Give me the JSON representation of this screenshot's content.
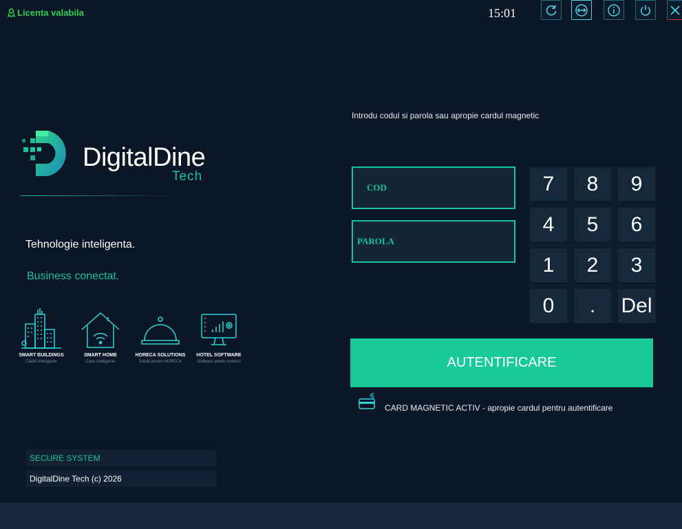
{
  "topbar": {
    "license": "Licenta valabila",
    "clock": "15:01",
    "icons": [
      "refresh-icon",
      "resize-icon",
      "info-icon",
      "power-icon",
      "close-icon"
    ]
  },
  "brand": {
    "name": "DigitalDine",
    "sub": "Tech",
    "tagline1": "Tehnologie inteligenta.",
    "tagline2": "Business conectat."
  },
  "features": [
    {
      "title": "SMART BUILDINGS",
      "sub": "Clădiri inteligente",
      "icon": "buildings-icon"
    },
    {
      "title": "SMART HOME",
      "sub": "Case inteligente",
      "icon": "smart-home-icon"
    },
    {
      "title": "HORECA SOLUTIONS",
      "sub": "Soluții pentru HORECA",
      "icon": "cloche-icon"
    },
    {
      "title": "HOTEL SOFTWARE",
      "sub": "Software pentru hoteluri",
      "icon": "monitor-chart-icon"
    }
  ],
  "footer": {
    "secure": "SECURE SYSTEM",
    "copyright": "DigitalDine Tech (c) 2026"
  },
  "login": {
    "instruction": "Introdu codul si parola sau apropie cardul magnetic",
    "code_label": "COD",
    "password_label": "PAROLA",
    "keys": [
      "7",
      "8",
      "9",
      "4",
      "5",
      "6",
      "1",
      "2",
      "3",
      "0",
      ".",
      "Del"
    ],
    "auth_button": "AUTENTIFICARE",
    "card_status": "CARD MAGNETIC ACTIV - apropie cardul pentru autentificare"
  },
  "colors": {
    "accent": "#17c59b",
    "background": "#0b1626",
    "license": "#2fd052"
  }
}
